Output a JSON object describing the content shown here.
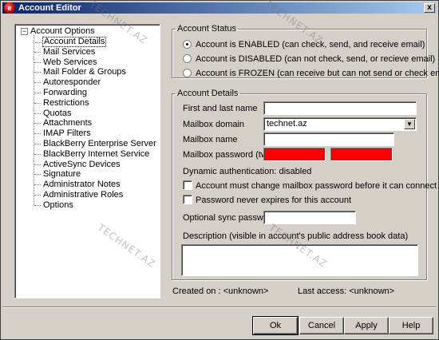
{
  "window": {
    "title": "Account Editor",
    "close_glyph": "x",
    "app_icon_glyph": "e"
  },
  "tree": {
    "expander_glyph": "−",
    "root": "Account Options",
    "items": [
      {
        "label": "Account Details",
        "selected": true
      },
      {
        "label": "Mail Services"
      },
      {
        "label": "Web Services"
      },
      {
        "label": "Mail Folder & Groups"
      },
      {
        "label": "Autoresponder"
      },
      {
        "label": "Forwarding"
      },
      {
        "label": "Restrictions"
      },
      {
        "label": "Quotas"
      },
      {
        "label": "Attachments"
      },
      {
        "label": "IMAP Filters"
      },
      {
        "label": "BlackBerry Enterprise Server"
      },
      {
        "label": "BlackBerry Internet Service"
      },
      {
        "label": "ActiveSync Devices"
      },
      {
        "label": "Signature"
      },
      {
        "label": "Administrator Notes"
      },
      {
        "label": "Administrative Roles"
      },
      {
        "label": "Options"
      }
    ]
  },
  "status": {
    "legend": "Account Status",
    "options": [
      {
        "label": "Account is ENABLED (can check, send, and receive email)",
        "checked": true
      },
      {
        "label": "Account is DISABLED (can not check, send, or recieve email)",
        "checked": false
      },
      {
        "label": "Account is FROZEN (can receive but can not send or check email)",
        "checked": false
      }
    ]
  },
  "details": {
    "legend": "Account Details",
    "name_label": "First and last name",
    "name_value": "",
    "domain_label": "Mailbox domain",
    "domain_value": "technet.az",
    "mailbox_label": "Mailbox name",
    "mailbox_value": "",
    "password_label": "Mailbox password (twice)",
    "dynamic_auth": "Dynamic authentication: disabled",
    "must_change_label": "Account must change mailbox password before it can connect",
    "never_expires_label": "Password never expires for this account",
    "sync_label": "Optional sync password",
    "sync_value": "",
    "description_label": "Description (visible in account's public address book data)",
    "description_value": "",
    "password_fill_color": "#ff0000"
  },
  "footer": {
    "created": "Created on : <unknown>",
    "last_access": "Last access: <unknown>"
  },
  "buttons": {
    "ok": "Ok",
    "cancel": "Cancel",
    "apply": "Apply",
    "help": "Help"
  },
  "watermark": "TECHNET.AZ"
}
